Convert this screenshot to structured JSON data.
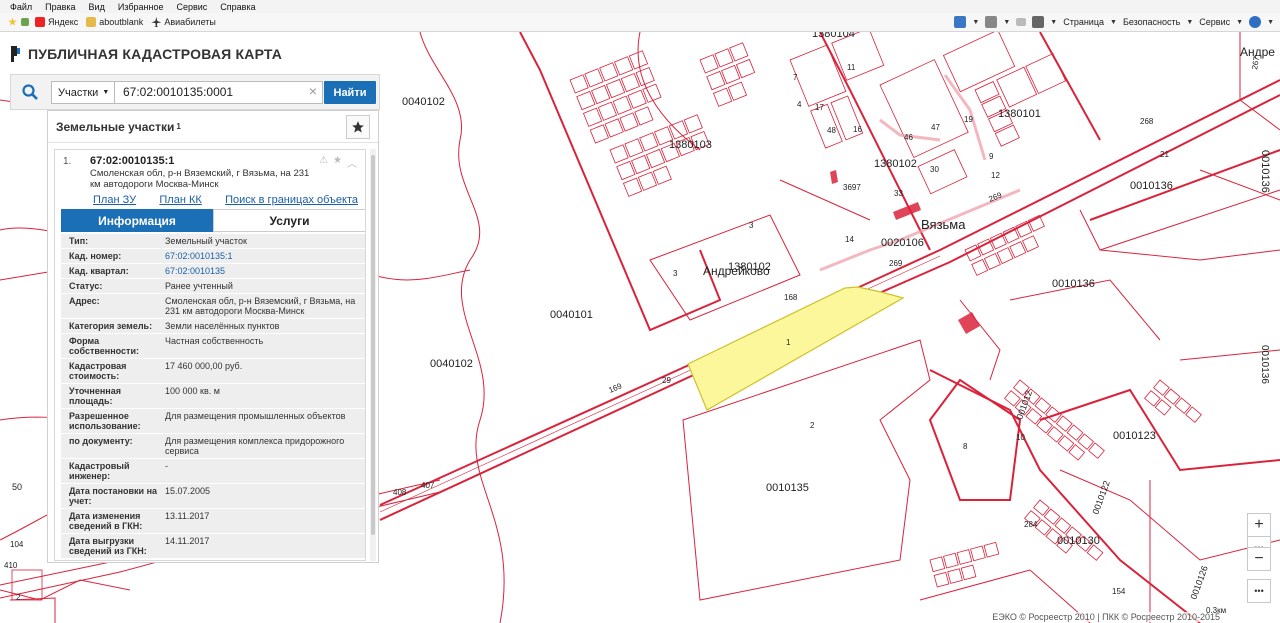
{
  "browser": {
    "menu": [
      "Файл",
      "Правка",
      "Вид",
      "Избранное",
      "Сервис",
      "Справка"
    ],
    "favorites": [
      "Яндекс",
      "aboutblank",
      "Авиабилеты"
    ],
    "toolbar": [
      "Страница",
      "Безопасность",
      "Сервис"
    ]
  },
  "app": {
    "title": "ПУБЛИЧНАЯ КАДАСТРОВАЯ КАРТА"
  },
  "search": {
    "type": "Участки",
    "query": "67:02:0010135:0001",
    "button": "Найти"
  },
  "panel": {
    "title": "Земельные участки",
    "title_sup": "1",
    "result": {
      "num": "1.",
      "id": "67:02:0010135:1",
      "address": "Смоленская обл, р-н Вяземский, г Вязьма, на 231 км автодороги Москва-Минск",
      "links": [
        "План ЗУ →",
        "План КК →",
        "Поиск в границах объекта →"
      ]
    },
    "tabs": {
      "info": "Информация",
      "services": "Услуги"
    },
    "props": [
      {
        "k": "Тип:",
        "v": "Земельный участок"
      },
      {
        "k": "Кад. номер:",
        "v": "67:02:0010135:1"
      },
      {
        "k": "Кад. квартал:",
        "v": "67:02:0010135"
      },
      {
        "k": "Статус:",
        "v": "Ранее учтенный"
      },
      {
        "k": "Адрес:",
        "v": "Смоленская обл, р-н Вяземский, г Вязьма, на 231 км автодороги Москва-Минск"
      },
      {
        "k": "Категория земель:",
        "v": "Земли населённых пунктов"
      },
      {
        "k": "Форма собственности:",
        "v": "Частная собственность"
      },
      {
        "k": "Кадастровая стоимость:",
        "v": "17 460 000,00 руб."
      },
      {
        "k": "Уточненная площадь:",
        "v": "100 000 кв. м"
      },
      {
        "k": "Разрешенное использование:",
        "v": "Для размещения промышленных объектов"
      },
      {
        "k": "по документу:",
        "v": "Для размещения комплекса придорожного сервиса"
      },
      {
        "k": "Кадастровый инженер:",
        "v": "-"
      },
      {
        "k": "Дата постановки на учет:",
        "v": "15.07.2005"
      },
      {
        "k": "Дата изменения сведений в ГКН:",
        "v": "13.11.2017"
      },
      {
        "k": "Дата выгрузки сведений из ГКН:",
        "v": "14.11.2017"
      }
    ]
  },
  "map": {
    "labels": {
      "q0040102a": "0040102",
      "q0040102b": "0040102",
      "q0040101": "0040101",
      "q1380104": "1380104",
      "q1380103": "1380103",
      "q1380102": "1380102",
      "q1380101": "1380101",
      "q1380102b": "1380102",
      "q0010136a": "0010136",
      "q0010136b": "0010136",
      "q0010136c": "0010136",
      "q0020106": "0020106",
      "q0010123": "0010123",
      "q0010130": "0010130",
      "q0010135": "0010135",
      "town": "Вязьма",
      "village": "Андрейково",
      "andr": "Андре",
      "p1": "1",
      "p2": "2",
      "p3": "3",
      "p3b": "3",
      "p8": "8",
      "p11": "11",
      "p21": "21",
      "p168": "168",
      "p169": "169",
      "p29": "29",
      "p268": "268",
      "p269": "269",
      "p269b": "269",
      "p3697": "3697",
      "p14": "14",
      "p4": "4",
      "p47": "47",
      "p46": "46",
      "p30": "30",
      "p33": "33",
      "p284": "284",
      "p154": "154",
      "p408": "408",
      "p407": "407",
      "p410": "410",
      "p104": "104",
      "p10": "10",
      "p12": "12",
      "p9": "9",
      "p7": "7",
      "p48": "48",
      "p19": "19",
      "p16": "16",
      "p17": "17",
      "p267": "267",
      "p00101": "001012",
      "p001072": "0010122",
      "p0010126": "0010126",
      "pq10": "10"
    }
  },
  "footer": {
    "copyright": "ЕЭКО © Росреестр 2010 | ПКК © Росреестр 2010-2015",
    "scale": "0.3км"
  }
}
